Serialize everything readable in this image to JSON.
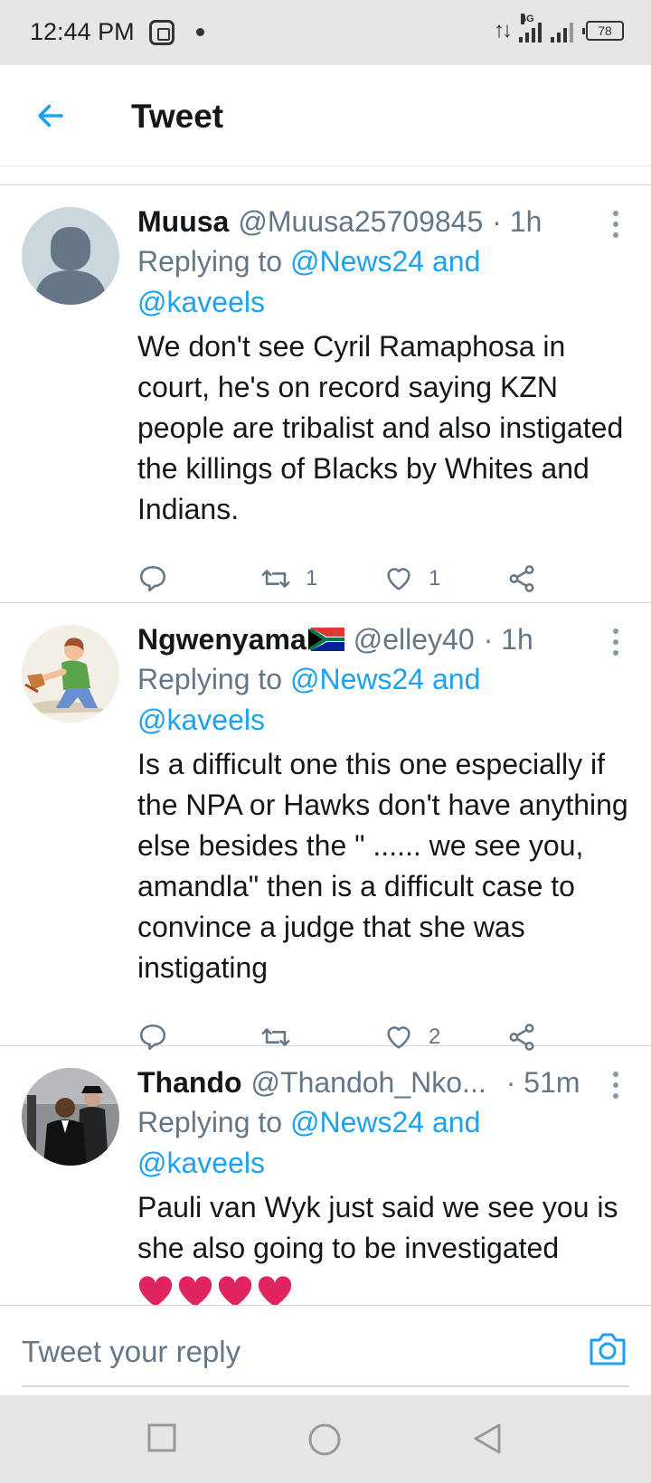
{
  "status_bar": {
    "time": "12:44 PM",
    "network": "4G",
    "battery": "78"
  },
  "header": {
    "title": "Tweet"
  },
  "tweets": [
    {
      "name": "Muusa",
      "handle": "@Muusa25709845",
      "time": "· 1h",
      "reply_prefix": "Replying to ",
      "reply_mention_1": "@News24",
      "reply_and": " and",
      "reply_mention_2": "@kaveels",
      "text": "We don't see Cyril Ramaphosa in court, he's on record saying KZN people are tribalist and also instigated the killings of Blacks by Whites and Indians.",
      "retweets": "1",
      "likes": "1"
    },
    {
      "name": "Ngwenyama",
      "handle": "@elley40",
      "time": "· 1h",
      "reply_prefix": "Replying to ",
      "reply_mention_1": "@News24",
      "reply_and": " and",
      "reply_mention_2": "@kaveels",
      "text": "Is a difficult one this one especially if the NPA or Hawks don't have anything else besides the \" ...... we see you, amandla\" then is a difficult case to convince a judge that she was instigating",
      "retweets": "",
      "likes": "2"
    },
    {
      "name": "Thando",
      "handle": "@Thandoh_Nko...",
      "time": "· 51m",
      "reply_prefix": "Replying to ",
      "reply_mention_1": "@News24",
      "reply_and": " and",
      "reply_mention_2": "@kaveels",
      "text": "Pauli van Wyk just said we see you is she also going to be investigated"
    }
  ],
  "reply_bar": {
    "placeholder": "Tweet your reply"
  },
  "colors": {
    "accent": "#1da1f2",
    "secondary_text": "#657786",
    "primary_text": "#14171a"
  },
  "icons": [
    "back-arrow-icon",
    "more-icon",
    "reply-icon",
    "retweet-icon",
    "like-icon",
    "share-icon",
    "camera-icon",
    "recents-icon",
    "home-icon",
    "back-nav-icon"
  ]
}
